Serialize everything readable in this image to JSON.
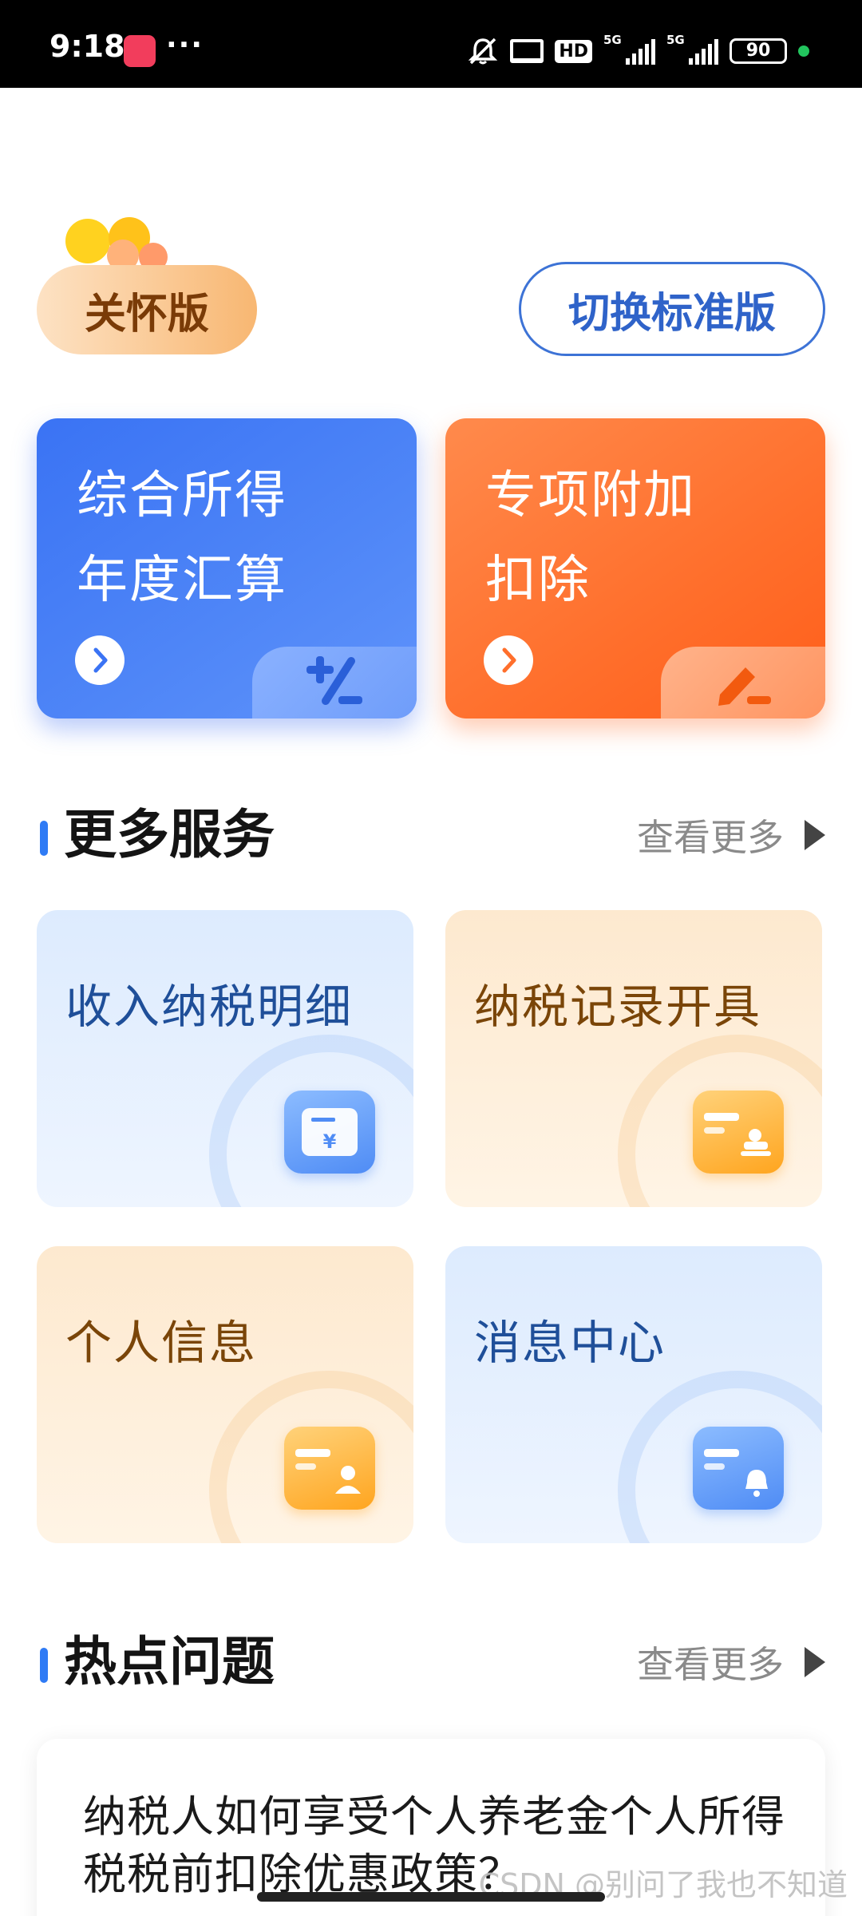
{
  "status_bar": {
    "time": "9:18",
    "more": "···",
    "hd": "HD",
    "net1": "5G",
    "net2": "5G",
    "battery": "90"
  },
  "header": {
    "care_badge": "关怀版",
    "switch_button": "切换标准版"
  },
  "main_cards": [
    {
      "line1": "综合所得",
      "line2": "年度汇算",
      "icon": "plus-percent-icon",
      "color": "#3a73f4"
    },
    {
      "line1": "专项附加",
      "line2": "扣除",
      "icon": "pencil-icon",
      "color": "#ff6f2c"
    }
  ],
  "more_services": {
    "title": "更多服务",
    "more_label": "查看更多",
    "items": [
      {
        "label": "收入纳税明细",
        "icon": "wallet-yen-icon"
      },
      {
        "label": "纳税记录开具",
        "icon": "stamp-card-icon"
      },
      {
        "label": "个人信息",
        "icon": "id-card-icon"
      },
      {
        "label": "消息中心",
        "icon": "message-bell-icon"
      }
    ]
  },
  "hot_questions": {
    "title": "热点问题",
    "more_label": "查看更多",
    "items": [
      {
        "text": "纳税人如何享受个人养老金个人所得税税前扣除优惠政策？"
      }
    ]
  },
  "watermark": "CSDN @别问了我也不知道"
}
